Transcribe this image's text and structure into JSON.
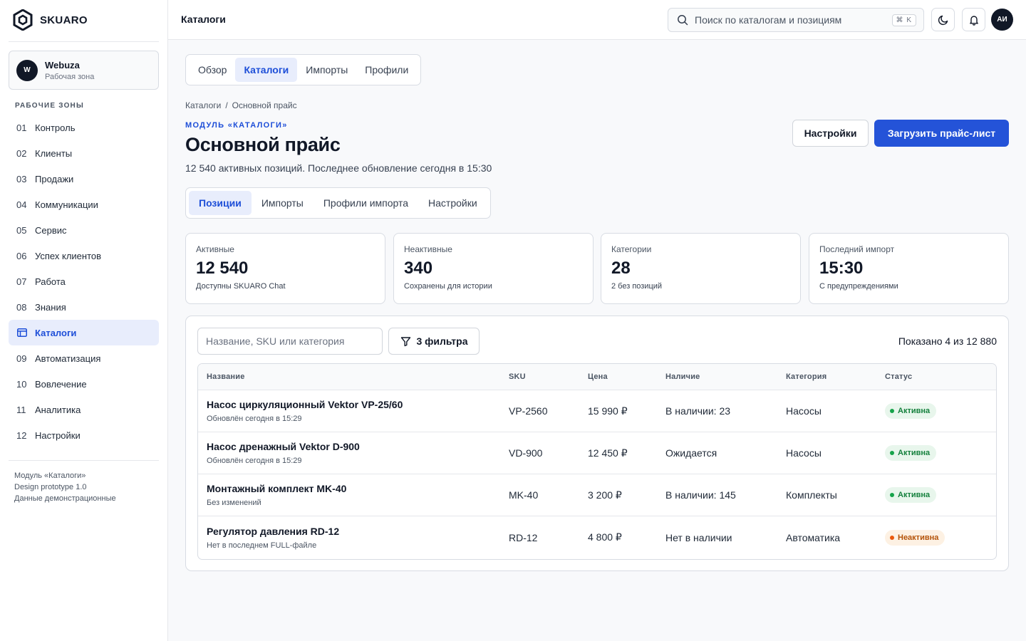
{
  "app": {
    "brand": "SKUARO"
  },
  "workspace": {
    "avatar": "W",
    "name": "Webuza",
    "subtitle": "Рабочая зона"
  },
  "sidebar": {
    "section_label": "РАБОЧИЕ ЗОНЫ",
    "items": [
      {
        "num": "01",
        "label": "Контроль"
      },
      {
        "num": "02",
        "label": "Клиенты"
      },
      {
        "num": "03",
        "label": "Продажи"
      },
      {
        "num": "04",
        "label": "Коммуникации"
      },
      {
        "num": "05",
        "label": "Сервис"
      },
      {
        "num": "06",
        "label": "Успех клиентов"
      },
      {
        "num": "07",
        "label": "Работа"
      },
      {
        "num": "08",
        "label": "Знания"
      },
      {
        "num": "",
        "label": "Каталоги",
        "icon": "catalog-icon",
        "active": true
      },
      {
        "num": "09",
        "label": "Автоматизация"
      },
      {
        "num": "10",
        "label": "Вовлечение"
      },
      {
        "num": "11",
        "label": "Аналитика"
      },
      {
        "num": "12",
        "label": "Настройки"
      }
    ],
    "footer": [
      "Модуль «Каталоги»",
      "Design prototype 1.0",
      "Данные демонстрационные"
    ]
  },
  "topbar": {
    "title": "Каталоги",
    "search_placeholder": "Поиск по каталогам и позициям",
    "shortcut": "⌘ K",
    "user_initials": "АИ"
  },
  "main_tabs": [
    "Обзор",
    "Каталоги",
    "Импорты",
    "Профили"
  ],
  "main_tabs_active": "Каталоги",
  "breadcrumb": [
    "Каталоги",
    "/",
    "Основной прайс"
  ],
  "page": {
    "module_label": "МОДУЛЬ «КАТАЛОГИ»",
    "title": "Основной прайс",
    "subtitle": "12 540 активных позиций. Последнее обновление сегодня в 15:30",
    "settings_button": "Настройки",
    "upload_button": "Загрузить прайс-лист"
  },
  "sub_tabs": [
    "Позиции",
    "Импорты",
    "Профили импорта",
    "Настройки"
  ],
  "sub_tabs_active": "Позиции",
  "stats": [
    {
      "label": "Активные",
      "value": "12 540",
      "note": "Доступны SKUARO Chat"
    },
    {
      "label": "Неактивные",
      "value": "340",
      "note": "Сохранены для истории"
    },
    {
      "label": "Категории",
      "value": "28",
      "note": "2 без позиций"
    },
    {
      "label": "Последний импорт",
      "value": "15:30",
      "note": "С предупреждениями"
    }
  ],
  "table_panel": {
    "filter_placeholder": "Название, SKU или категория",
    "filter_button": "3 фильтра",
    "shown_text": "Показано 4 из 12 880",
    "columns": [
      "Название",
      "SKU",
      "Цена",
      "Наличие",
      "Категория",
      "Статус"
    ],
    "rows": [
      {
        "name": "Насос циркуляционный Vektor VP-25/60",
        "sub": "Обновлён сегодня в 15:29",
        "sku": "VP-2560",
        "price": "15 990 ₽",
        "availability": "В наличии: 23",
        "category": "Насосы",
        "status": "Активна",
        "status_kind": "ok"
      },
      {
        "name": "Насос дренажный Vektor D-900",
        "sub": "Обновлён сегодня в 15:29",
        "sku": "VD-900",
        "price": "12 450 ₽",
        "availability": "Ожидается",
        "category": "Насосы",
        "status": "Активна",
        "status_kind": "ok"
      },
      {
        "name": "Монтажный комплект MK-40",
        "sub": "Без изменений",
        "sku": "MK-40",
        "price": "3 200 ₽",
        "availability": "В наличии: 145",
        "category": "Комплекты",
        "status": "Активна",
        "status_kind": "ok"
      },
      {
        "name": "Регулятор давления RD-12",
        "sub": "Нет в последнем FULL-файле",
        "sku": "RD-12",
        "price": "4 800 ₽",
        "availability": "Нет в наличии",
        "category": "Автоматика",
        "status": "Неактивна",
        "status_kind": "off"
      }
    ]
  },
  "colors": {
    "accent": "#2453d8",
    "active_bg": "#e8edfc",
    "ok": "#15803d",
    "warn": "#b45309"
  }
}
